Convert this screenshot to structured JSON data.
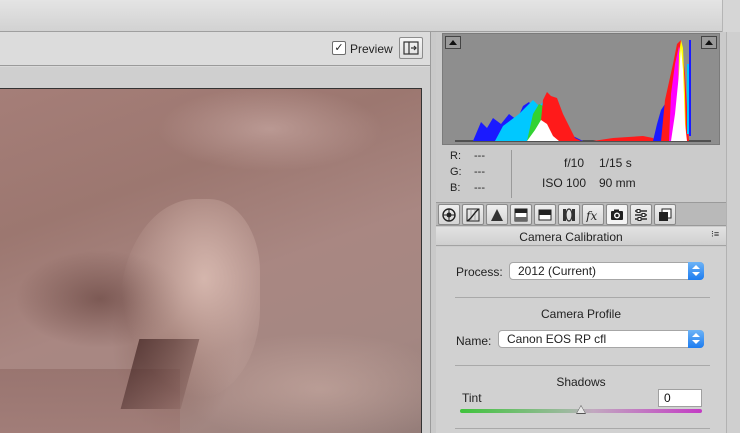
{
  "toolbar": {
    "preview_label": "Preview",
    "preview_checked": true,
    "check_glyph": "✓"
  },
  "readout": {
    "r_label": "R:",
    "r_value": "---",
    "g_label": "G:",
    "g_value": "---",
    "b_label": "B:",
    "b_value": "---"
  },
  "exif": {
    "aperture": "f/10",
    "shutter": "1/15 s",
    "iso": "ISO 100",
    "focal_length": "90 mm"
  },
  "tabs": [
    {
      "name": "basic-tab-icon"
    },
    {
      "name": "tone-curve-tab-icon"
    },
    {
      "name": "detail-tab-icon"
    },
    {
      "name": "hsl-tab-icon"
    },
    {
      "name": "split-toning-tab-icon"
    },
    {
      "name": "lens-corrections-tab-icon"
    },
    {
      "name": "effects-tab-icon"
    },
    {
      "name": "camera-calibration-tab-icon",
      "active": true
    },
    {
      "name": "presets-tab-icon"
    },
    {
      "name": "snapshots-tab-icon"
    }
  ],
  "panel": {
    "title": "Camera Calibration",
    "menu_glyph": "⁝≡",
    "process_label": "Process:",
    "process_value": "2012 (Current)",
    "camera_profile_title": "Camera Profile",
    "name_label": "Name:",
    "name_value": "Canon EOS RP cfl",
    "shadows_title": "Shadows",
    "tint_label": "Tint",
    "tint_value": "0",
    "tint_slider_fraction": 0.5
  },
  "colors": {
    "accent": "#1d7cf0",
    "histogram_bg": "#8e8e8e"
  }
}
